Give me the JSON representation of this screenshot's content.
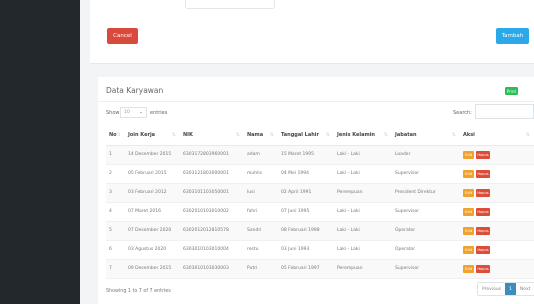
{
  "form": {
    "cancel_label": "Cancel",
    "add_label": "Tambah"
  },
  "table_card": {
    "title": "Data Karyawan",
    "print_label": "Print",
    "show_label": "Show",
    "page_size": "10",
    "entries_label": "entries",
    "search_label": "Search:",
    "columns": [
      "No",
      "Join Kerja",
      "NIK",
      "Nama",
      "Tanggal Lahir",
      "Jenis Kelamin",
      "Jabatan",
      "Aksi"
    ],
    "rows": [
      [
        "1",
        "14 Desember 2015",
        "6303172803960001",
        "adam",
        "15 Maret 1995",
        "Laki - Laki",
        "Loader"
      ],
      [
        "2",
        "05 Februari 2015",
        "6303121803000001",
        "muhlis",
        "04 Mei 1994",
        "Laki - Laki",
        "Supervisor"
      ],
      [
        "3",
        "03 Februari 2012",
        "6303101103050001",
        "lusi",
        "02 April 1991",
        "Perempuan",
        "President Direktur"
      ],
      [
        "4",
        "07 Maret 2016",
        "6302010103010002",
        "fahri",
        "07 Juni 1995",
        "Laki - Laki",
        "Supervisor"
      ],
      [
        "5",
        "07 Desember 2020",
        "6302012012810578",
        "Sandri",
        "08 Februari 1998",
        "Laki - Laki",
        "Operator"
      ],
      [
        "6",
        "03 Agustus 2020",
        "6303010103010004",
        "restu",
        "03 Juni 1993",
        "Laki - Laki",
        "Operator"
      ],
      [
        "7",
        "09 Desember 2015",
        "6303010103030003",
        "Putri",
        "05 Februari 1997",
        "Perempuan",
        "Supervisor"
      ]
    ],
    "edit_label": "Edit",
    "delete_label": "Hapus",
    "info": "Showing 1 to 7 of 7 entries",
    "pager": {
      "previous": "Previous",
      "current": "1",
      "next": "Next"
    }
  },
  "colors": {
    "sidebar": "#22282c",
    "cancel": "#d94a3c",
    "add": "#2aa8e8",
    "print": "#2bbc55",
    "edit": "#f0a22e",
    "delete": "#dd4b39",
    "page_active": "#3c8dbc"
  }
}
